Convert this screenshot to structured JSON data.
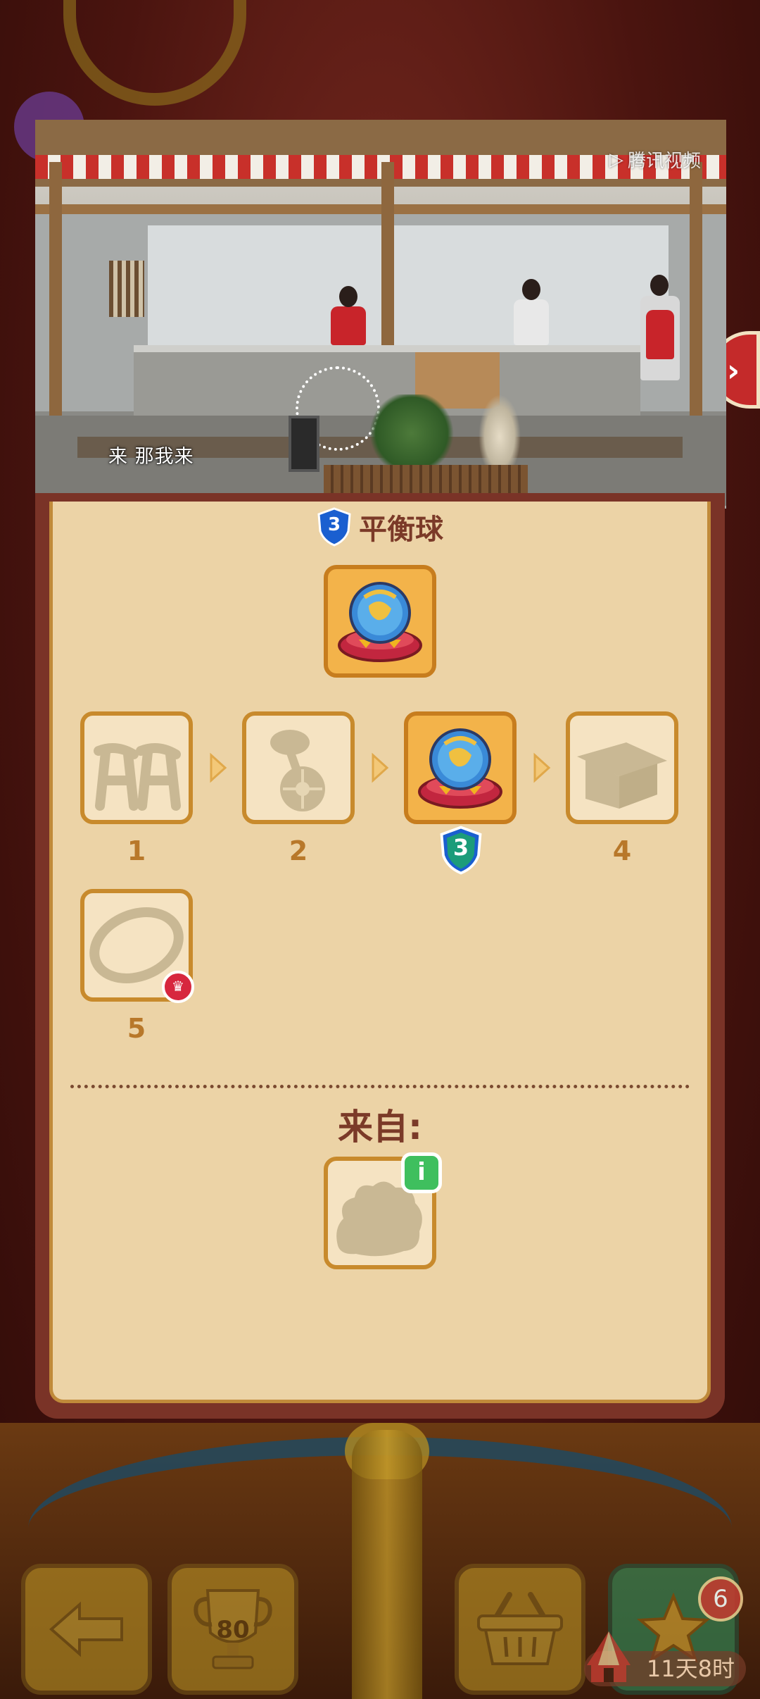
{
  "video": {
    "subtitle": "来 那我来",
    "watermark": "腾讯视频",
    "progress": 0.62
  },
  "panel": {
    "level_badge": "3",
    "title": "平衡球",
    "chain": [
      {
        "label": "1",
        "icon": "stilts-silhouette",
        "unlocked": false
      },
      {
        "label": "2",
        "icon": "unicycle-silhouette",
        "unlocked": false
      },
      {
        "label": "",
        "icon": "balance-ball-icon",
        "unlocked": true,
        "current_level": "3"
      },
      {
        "label": "4",
        "icon": "platform-silhouette",
        "unlocked": false
      },
      {
        "label": "5",
        "icon": "hoop-silhouette",
        "unlocked": false,
        "premium": true
      }
    ],
    "from_label": "来自:",
    "info_label": "i"
  },
  "bottom_bar": {
    "trophy_value": "80",
    "star_count": "6",
    "timer": "11天8时"
  },
  "colors": {
    "panel_bg": "#ecd3a6",
    "title": "#7b3a28",
    "tile_border": "#c88a2c",
    "active_tile": "#f3b34a",
    "shield_blue": "#1a5fd0",
    "info_green": "#3fbf5e"
  }
}
